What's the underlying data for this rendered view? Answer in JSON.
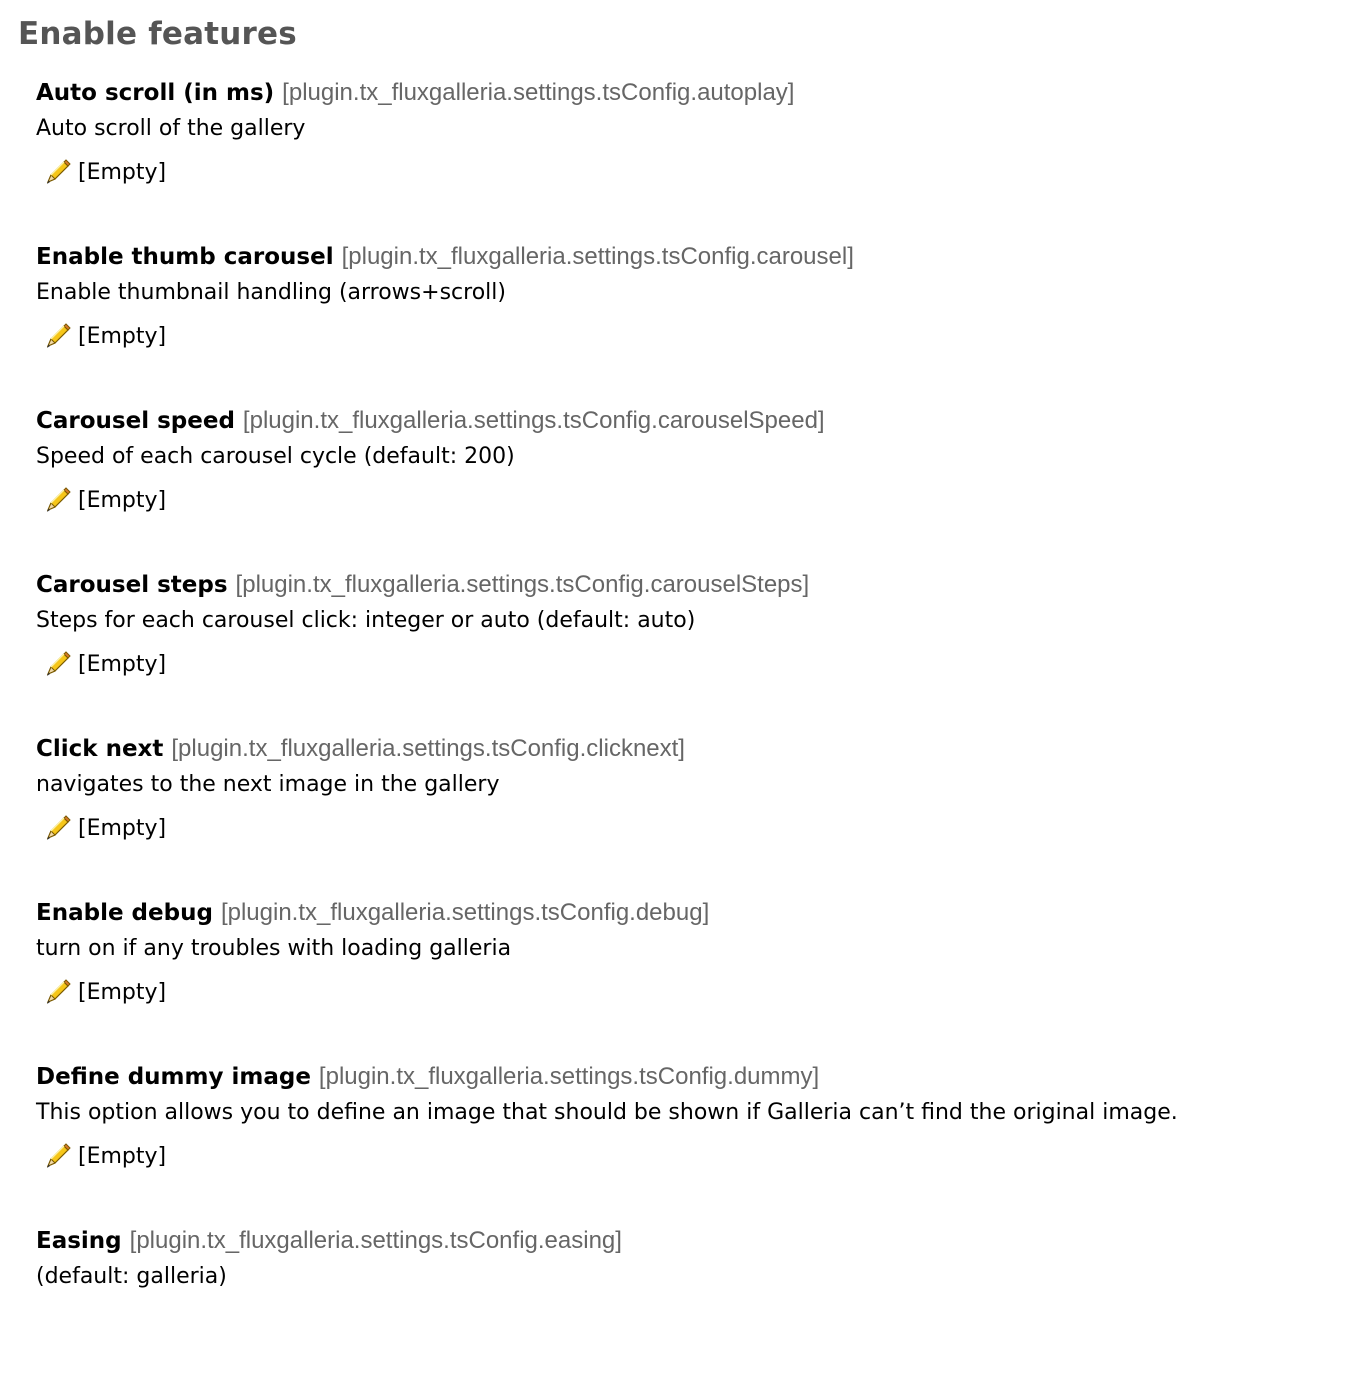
{
  "section": {
    "title": "Enable features"
  },
  "settings": [
    {
      "label": "Auto scroll (in ms)",
      "key": "[plugin.tx_fluxgalleria.settings.tsConfig.autoplay]",
      "description": "Auto scroll of the gallery",
      "value": "[Empty]"
    },
    {
      "label": "Enable thumb carousel",
      "key": "[plugin.tx_fluxgalleria.settings.tsConfig.carousel]",
      "description": "Enable thumbnail handling (arrows+scroll)",
      "value": "[Empty]"
    },
    {
      "label": "Carousel speed",
      "key": "[plugin.tx_fluxgalleria.settings.tsConfig.carouselSpeed]",
      "description": "Speed of each carousel cycle (default: 200)",
      "value": "[Empty]"
    },
    {
      "label": "Carousel steps",
      "key": "[plugin.tx_fluxgalleria.settings.tsConfig.carouselSteps]",
      "description": "Steps for each carousel click: integer or auto (default: auto)",
      "value": "[Empty]"
    },
    {
      "label": "Click next",
      "key": "[plugin.tx_fluxgalleria.settings.tsConfig.clicknext]",
      "description": "navigates to the next image in the gallery",
      "value": "[Empty]"
    },
    {
      "label": "Enable debug",
      "key": "[plugin.tx_fluxgalleria.settings.tsConfig.debug]",
      "description": "turn on if any troubles with loading galleria",
      "value": "[Empty]"
    },
    {
      "label": "Define dummy image",
      "key": "[plugin.tx_fluxgalleria.settings.tsConfig.dummy]",
      "description": "This option allows you to define an image that should be shown if Galleria can’t find the original image.",
      "value": "[Empty]"
    },
    {
      "label": "Easing",
      "key": "[plugin.tx_fluxgalleria.settings.tsConfig.easing]",
      "description": "(default: galleria)"
    }
  ],
  "icons": {
    "edit": "pencil-icon"
  },
  "colors": {
    "title": "#555555",
    "key": "#666666",
    "text": "#000000"
  }
}
